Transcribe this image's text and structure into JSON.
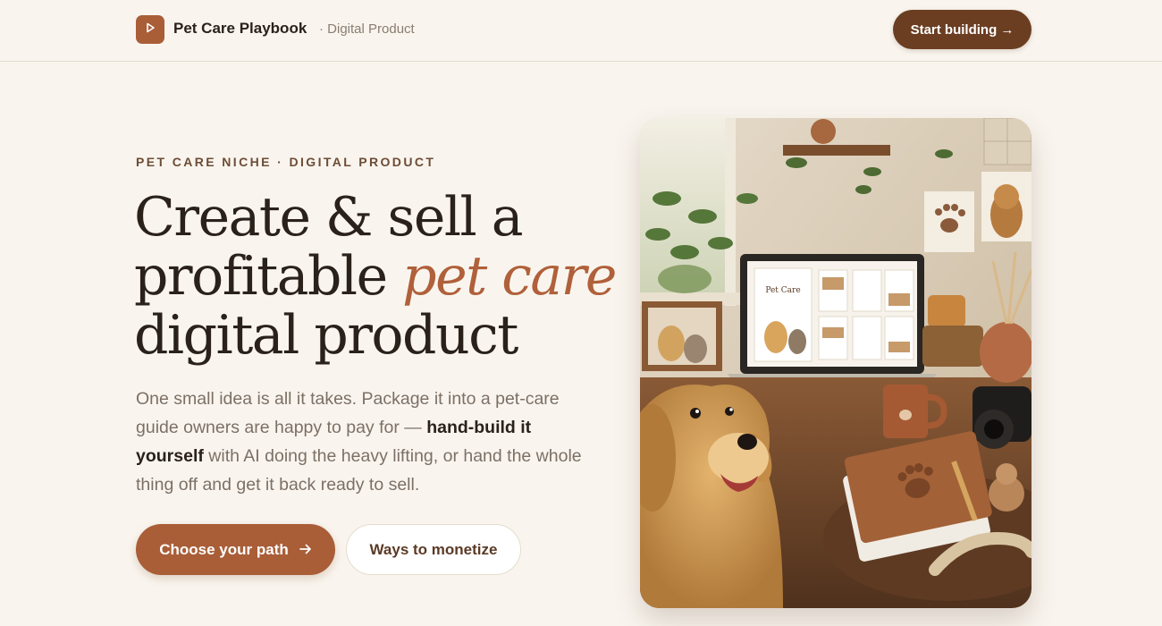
{
  "header": {
    "logo_icon": "play-icon",
    "brand_name": "Pet Care Playbook",
    "brand_sub": "· Digital Product",
    "cta_label": "Start building →"
  },
  "hero": {
    "eyebrow": "PET CARE NICHE · DIGITAL PRODUCT",
    "headline_line1": "Create & sell a",
    "headline_line2_plain": "profitable ",
    "headline_line2_accent": "pet care",
    "headline_line3": "digital product",
    "description_part1": "One small idea is all it takes. Package it into a pet-care guide owners are happy to pay for — ",
    "description_bold": "hand-build it yourself",
    "description_part2": " with AI doing the heavy lifting, or hand the whole thing off and get it back ready to sell.",
    "primary_cta": "Choose your path",
    "primary_cta_icon": "arrow-right-icon",
    "secondary_cta": "Ways to monetize",
    "image_book_title": "Pet Care"
  },
  "colors": {
    "background": "#f9f5ee",
    "brand_brown": "#a95e38",
    "dark_brown": "#6b3e22",
    "heading": "#2a211b",
    "body_text": "#7c7066"
  }
}
